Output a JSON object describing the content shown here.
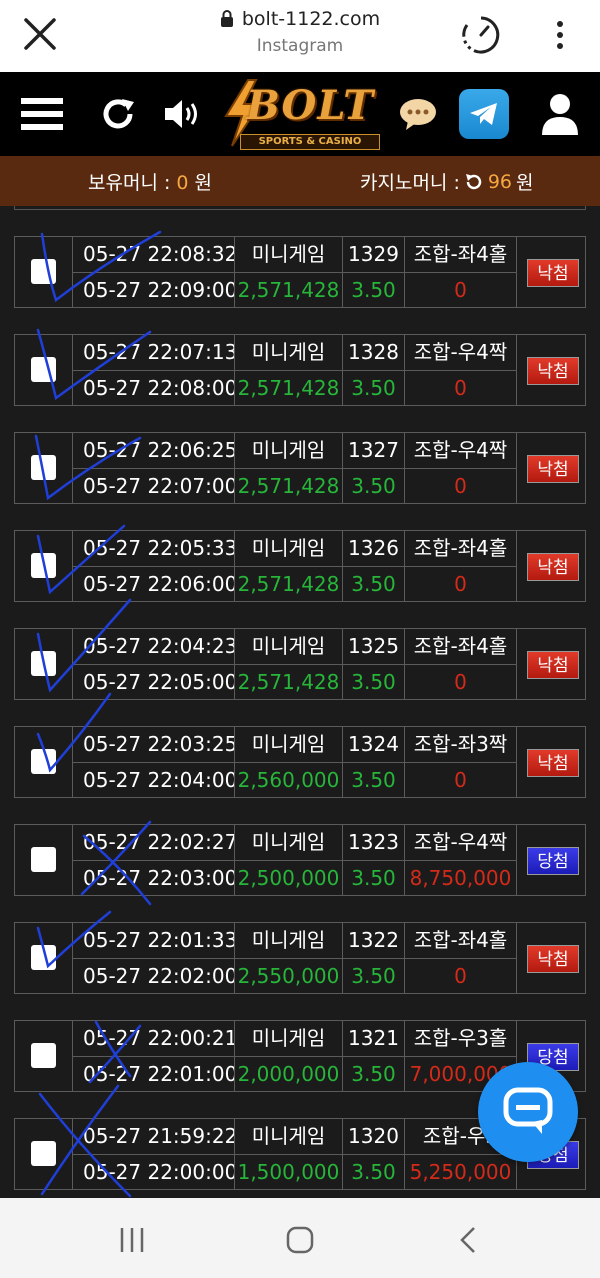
{
  "browser": {
    "url": "bolt-1122.com",
    "source": "Instagram"
  },
  "header": {
    "logo_text": "BOLT",
    "logo_sub": "SPORTS & CASINO"
  },
  "balance": {
    "money_label": "보유머니 : ",
    "money_value": "0",
    "money_unit": " 원",
    "casino_label": "카지노머니 : ",
    "casino_value": "96",
    "casino_unit": " 원"
  },
  "bets": [
    {
      "bet_time": "05-27 22:08:32",
      "result_time": "05-27 22:09:00",
      "game": "미니게임",
      "round": "1329",
      "pick": "조합-좌4홀",
      "amount": "2,571,428",
      "odds": "3.50",
      "payout": "0",
      "status": "낙첨",
      "won": false
    },
    {
      "bet_time": "05-27 22:07:13",
      "result_time": "05-27 22:08:00",
      "game": "미니게임",
      "round": "1328",
      "pick": "조합-우4짝",
      "amount": "2,571,428",
      "odds": "3.50",
      "payout": "0",
      "status": "낙첨",
      "won": false
    },
    {
      "bet_time": "05-27 22:06:25",
      "result_time": "05-27 22:07:00",
      "game": "미니게임",
      "round": "1327",
      "pick": "조합-우4짝",
      "amount": "2,571,428",
      "odds": "3.50",
      "payout": "0",
      "status": "낙첨",
      "won": false
    },
    {
      "bet_time": "05-27 22:05:33",
      "result_time": "05-27 22:06:00",
      "game": "미니게임",
      "round": "1326",
      "pick": "조합-좌4홀",
      "amount": "2,571,428",
      "odds": "3.50",
      "payout": "0",
      "status": "낙첨",
      "won": false
    },
    {
      "bet_time": "05-27 22:04:23",
      "result_time": "05-27 22:05:00",
      "game": "미니게임",
      "round": "1325",
      "pick": "조합-좌4홀",
      "amount": "2,571,428",
      "odds": "3.50",
      "payout": "0",
      "status": "낙첨",
      "won": false
    },
    {
      "bet_time": "05-27 22:03:25",
      "result_time": "05-27 22:04:00",
      "game": "미니게임",
      "round": "1324",
      "pick": "조합-좌3짝",
      "amount": "2,560,000",
      "odds": "3.50",
      "payout": "0",
      "status": "낙첨",
      "won": false
    },
    {
      "bet_time": "05-27 22:02:27",
      "result_time": "05-27 22:03:00",
      "game": "미니게임",
      "round": "1323",
      "pick": "조합-우4짝",
      "amount": "2,500,000",
      "odds": "3.50",
      "payout": "8,750,000",
      "status": "당첨",
      "won": true
    },
    {
      "bet_time": "05-27 22:01:33",
      "result_time": "05-27 22:02:00",
      "game": "미니게임",
      "round": "1322",
      "pick": "조합-좌4홀",
      "amount": "2,550,000",
      "odds": "3.50",
      "payout": "0",
      "status": "낙첨",
      "won": false
    },
    {
      "bet_time": "05-27 22:00:21",
      "result_time": "05-27 22:01:00",
      "game": "미니게임",
      "round": "1321",
      "pick": "조합-우3홀",
      "amount": "2,000,000",
      "odds": "3.50",
      "payout": "7,000,000",
      "status": "당첨",
      "won": true
    },
    {
      "bet_time": "05-27 21:59:22",
      "result_time": "05-27 22:00:00",
      "game": "미니게임",
      "round": "1320",
      "pick": "조합-우3",
      "amount": "1,500,000",
      "odds": "3.50",
      "payout": "5,250,000",
      "status": "당첨",
      "won": true
    }
  ],
  "colors": {
    "balance_bar": "#5a2a10",
    "amount_green": "#27b53a",
    "payout_red": "#d42a1a",
    "lose_badge": "#d42a1a",
    "win_badge": "#2a2ad8",
    "ink_blue": "#1f3fd8"
  },
  "icons": {
    "close": "close-icon",
    "lock": "lock-icon",
    "timer": "timer-icon",
    "more": "kebab-menu-icon",
    "menu": "hamburger-menu-icon",
    "refresh": "refresh-icon",
    "sound": "speaker-icon",
    "message": "chat-bubble-icon",
    "telegram": "telegram-icon",
    "user": "user-icon",
    "live_chat": "live-chat-icon",
    "nav_recents": "recents-icon",
    "nav_home": "home-icon",
    "nav_back": "back-icon"
  }
}
